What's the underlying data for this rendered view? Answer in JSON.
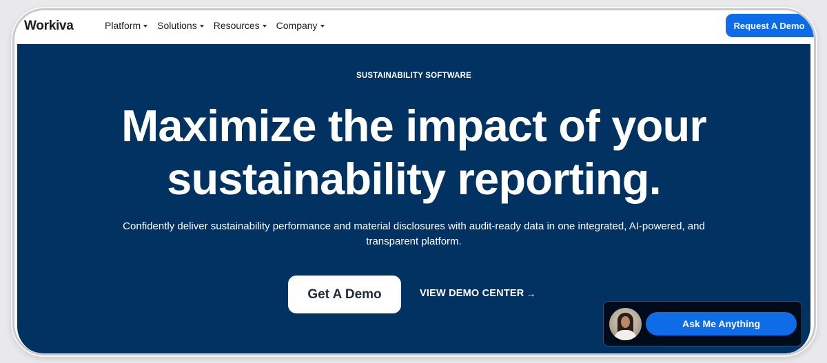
{
  "brand": {
    "logo_text": "Workiva",
    "accent": "#0f6ce8",
    "hero_bg": "#013262"
  },
  "nav": {
    "items": [
      {
        "label": "Platform"
      },
      {
        "label": "Solutions"
      },
      {
        "label": "Resources"
      },
      {
        "label": "Company"
      }
    ],
    "cta_label": "Request A Demo"
  },
  "hero": {
    "eyebrow": "SUSTAINABILITY SOFTWARE",
    "headline_line1": "Maximize the impact of your",
    "headline_line2": "sustainability reporting.",
    "subtext": "Confidently deliver sustainability performance and material disclosures with audit-ready data in one integrated, AI-powered, and transparent platform.",
    "primary_cta": "Get A Demo",
    "secondary_cta": "VIEW DEMO CENTER",
    "secondary_cta_icon": "→"
  },
  "chat": {
    "button_label": "Ask Me Anything",
    "avatar_icon": "agent-avatar"
  }
}
